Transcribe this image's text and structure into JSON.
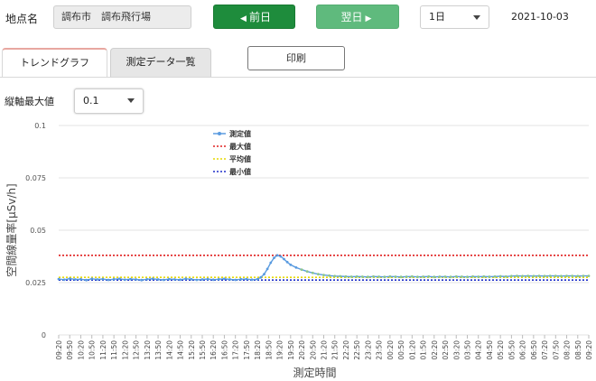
{
  "header": {
    "location_label": "地点名",
    "location_value": "調布市　調布飛行場",
    "prev_label": "前日",
    "prev_icon": "caret-left-icon",
    "next_label": "翌日",
    "next_icon": "caret-right-icon",
    "period_value": "1日",
    "date": "2021-10-03"
  },
  "tabs": [
    {
      "label": "トレンドグラフ",
      "active": true
    },
    {
      "label": "測定データ一覧",
      "active": false
    }
  ],
  "print_label": "印刷",
  "ymax": {
    "label": "縦軸最大値",
    "value": "0.1"
  },
  "colors": {
    "measured": "#5a9be0",
    "max": "#e02020",
    "avg": "#e6d800",
    "min": "#1f2fc8",
    "prev_button": "#1e8c3c",
    "next_button": "#5fba7d",
    "active_tab_accent": "#e8a7a0"
  },
  "chart_data": {
    "type": "line",
    "xlabel": "測定時間",
    "ylabel": "空間線量率[μSv/h]",
    "ylim": [
      0,
      0.1
    ],
    "yticks": [
      "0",
      "0.025",
      "0.05",
      "0.075",
      "0.1"
    ],
    "xticks": [
      "09:20",
      "09:50",
      "10:20",
      "10:50",
      "11:20",
      "11:50",
      "12:20",
      "12:50",
      "13:20",
      "13:50",
      "14:20",
      "14:50",
      "15:20",
      "15:50",
      "16:20",
      "16:50",
      "17:20",
      "17:50",
      "18:20",
      "18:50",
      "19:20",
      "19:50",
      "20:20",
      "20:50",
      "21:20",
      "21:50",
      "22:20",
      "22:50",
      "23:20",
      "23:50",
      "00:20",
      "00:50",
      "01:20",
      "01:50",
      "02:20",
      "02:50",
      "03:20",
      "03:50",
      "04:20",
      "04:50",
      "05:20",
      "05:50",
      "06:20",
      "06:50",
      "07:20",
      "07:50",
      "08:20",
      "08:50",
      "09:20"
    ],
    "grid": "horizontal",
    "legend_position": "top-center",
    "series": [
      {
        "name": "測定値",
        "style": "line-markers",
        "x": [
          0,
          0.5,
          1,
          1.5,
          2,
          2.5,
          3,
          3.5,
          4,
          4.5,
          5,
          5.5,
          6,
          6.5,
          7,
          7.5,
          8,
          8.5,
          9,
          9.5,
          10,
          10.5,
          11,
          11.5,
          12,
          12.5,
          13,
          13.5,
          14,
          14.5,
          15,
          15.5,
          16,
          16.5,
          17,
          17.5,
          18,
          18.3,
          18.6,
          18.9,
          19.2,
          19.5,
          19.8,
          20.1,
          20.4,
          20.7,
          21,
          21.5,
          22,
          22.5,
          23,
          23.5,
          24,
          24.5,
          25,
          25.5,
          26,
          26.5,
          27,
          27.5,
          28,
          28.5,
          29,
          29.5,
          30,
          30.5,
          31,
          31.5,
          32,
          32.5,
          33,
          33.5,
          34,
          34.5,
          35,
          35.5,
          36,
          36.5,
          37,
          37.5,
          38,
          38.5,
          39,
          39.5,
          40,
          40.5,
          41,
          41.5,
          42,
          42.5,
          43,
          43.5,
          44,
          44.5,
          45,
          45.5,
          46,
          46.5,
          47,
          47.5,
          48
        ],
        "y": [
          0.0267,
          0.0264,
          0.0269,
          0.0265,
          0.0266,
          0.0262,
          0.0268,
          0.0265,
          0.0267,
          0.0263,
          0.0266,
          0.0268,
          0.0264,
          0.0267,
          0.0265,
          0.0262,
          0.0266,
          0.0268,
          0.0265,
          0.0263,
          0.0267,
          0.0265,
          0.0264,
          0.0268,
          0.0266,
          0.0263,
          0.0265,
          0.0267,
          0.0264,
          0.0266,
          0.0268,
          0.0265,
          0.0263,
          0.0266,
          0.0267,
          0.0264,
          0.0266,
          0.0275,
          0.029,
          0.0315,
          0.0345,
          0.0368,
          0.038,
          0.0375,
          0.0362,
          0.0348,
          0.0335,
          0.0322,
          0.0312,
          0.0303,
          0.0296,
          0.029,
          0.0286,
          0.0283,
          0.0281,
          0.028,
          0.0279,
          0.0278,
          0.0279,
          0.0278,
          0.0277,
          0.0279,
          0.0278,
          0.0277,
          0.0279,
          0.0278,
          0.0277,
          0.0278,
          0.0279,
          0.0277,
          0.0278,
          0.0279,
          0.0277,
          0.0278,
          0.0278,
          0.0277,
          0.0279,
          0.0278,
          0.0277,
          0.0279,
          0.0278,
          0.0279,
          0.0278,
          0.0279,
          0.028,
          0.0279,
          0.0281,
          0.0282,
          0.0281,
          0.0282,
          0.0281,
          0.0282,
          0.0281,
          0.0282,
          0.0282,
          0.0281,
          0.0282,
          0.0282,
          0.0281,
          0.0282,
          0.0282
        ]
      },
      {
        "name": "最大値",
        "style": "dotted",
        "value": 0.038
      },
      {
        "name": "平均値",
        "style": "dotted",
        "value": 0.0275
      },
      {
        "name": "最小値",
        "style": "dotted",
        "value": 0.0262
      }
    ]
  }
}
